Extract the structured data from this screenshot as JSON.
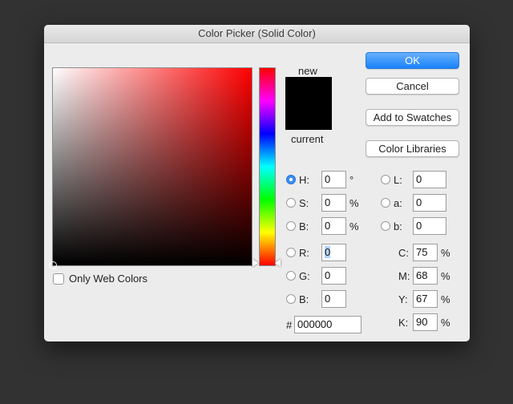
{
  "window": {
    "title": "Color Picker (Solid Color)"
  },
  "buttons": {
    "ok": "OK",
    "cancel": "Cancel",
    "add_swatches": "Add to Swatches",
    "color_libraries": "Color Libraries"
  },
  "preview": {
    "new_label": "new",
    "current_label": "current",
    "new_color": "#000000",
    "current_color": "#000000"
  },
  "options": {
    "only_web_colors": "Only Web Colors"
  },
  "hsb": {
    "h": {
      "label": "H:",
      "value": "0",
      "unit": "°"
    },
    "s": {
      "label": "S:",
      "value": "0",
      "unit": "%"
    },
    "b": {
      "label": "B:",
      "value": "0",
      "unit": "%"
    }
  },
  "rgb": {
    "r": {
      "label": "R:",
      "value": "0"
    },
    "g": {
      "label": "G:",
      "value": "0"
    },
    "b": {
      "label": "B:",
      "value": "0"
    }
  },
  "lab": {
    "l": {
      "label": "L:",
      "value": "0"
    },
    "a": {
      "label": "a:",
      "value": "0"
    },
    "b": {
      "label": "b:",
      "value": "0"
    }
  },
  "cmyk": {
    "c": {
      "label": "C:",
      "value": "75",
      "unit": "%"
    },
    "m": {
      "label": "M:",
      "value": "68",
      "unit": "%"
    },
    "y": {
      "label": "Y:",
      "value": "67",
      "unit": "%"
    },
    "k": {
      "label": "K:",
      "value": "90",
      "unit": "%"
    }
  },
  "hex": {
    "label": "#",
    "value": "000000"
  }
}
